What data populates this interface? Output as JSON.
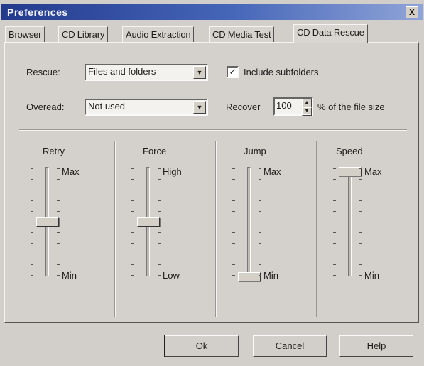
{
  "window": {
    "title": "Preferences",
    "close_label": "X"
  },
  "tabs": [
    {
      "label": "Browser"
    },
    {
      "label": "CD Library"
    },
    {
      "label": "Audio Extraction"
    },
    {
      "label": "CD Media Test"
    },
    {
      "label": "CD Data Rescue",
      "active": true
    }
  ],
  "rescue": {
    "label": "Rescue:",
    "value": "Files and folders"
  },
  "include_subfolders": {
    "label": "Include subfolders",
    "checked": true,
    "mark": "✓"
  },
  "overread": {
    "label": "Overead:",
    "value": "Not used"
  },
  "recover": {
    "label": "Recover",
    "value": "100",
    "suffix": "% of the file size"
  },
  "sliders": [
    {
      "title": "Retry",
      "max_label": "Max",
      "min_label": "Min",
      "level": 0.52
    },
    {
      "title": "Force",
      "max_label": "High",
      "min_label": "Low",
      "level": 0.52
    },
    {
      "title": "Jump",
      "max_label": "Max",
      "min_label": "Min",
      "level": 0.0
    },
    {
      "title": "Speed",
      "max_label": "Max",
      "min_label": "Min",
      "level": 1.0
    }
  ],
  "buttons": {
    "ok": "Ok",
    "cancel": "Cancel",
    "help": "Help"
  },
  "icons": {
    "combo_arrow": "▼",
    "spin_up": "▲",
    "spin_down": "▼"
  }
}
